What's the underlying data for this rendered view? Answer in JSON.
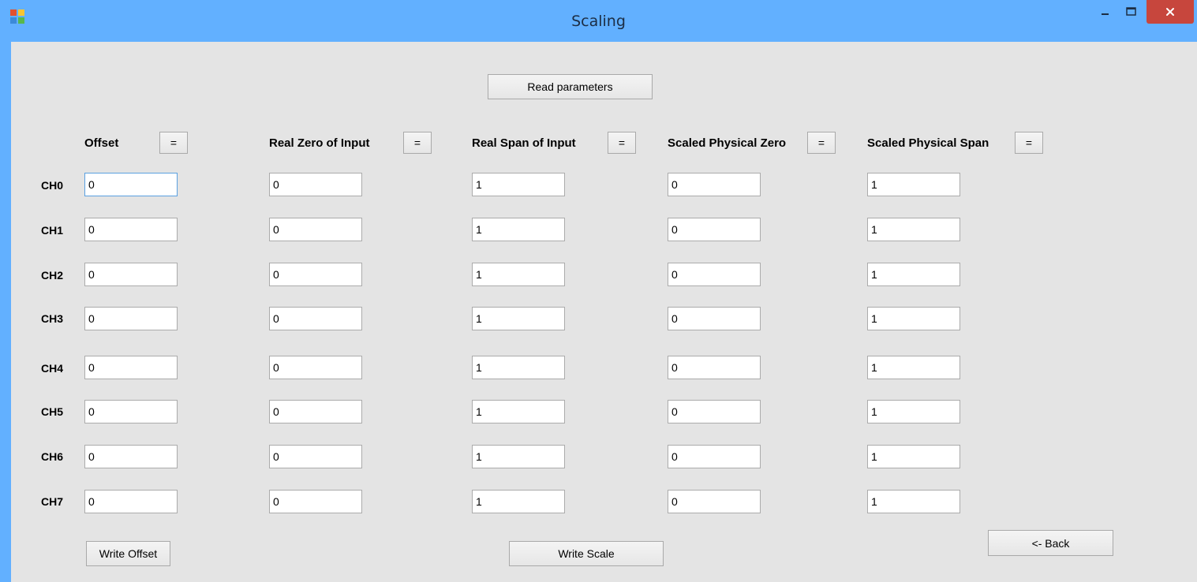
{
  "window": {
    "title": "Scaling",
    "minimize_glyph": "–",
    "maximize_glyph": "☐",
    "close_glyph": "✕"
  },
  "toolbar": {
    "read_parameters_label": "Read parameters",
    "write_offset_label": "Write Offset",
    "write_scale_label": "Write Scale",
    "back_label": "<- Back"
  },
  "columns": [
    {
      "key": "offset",
      "header": "Offset",
      "eq_label": "="
    },
    {
      "key": "real_zero",
      "header": "Real Zero of Input",
      "eq_label": "="
    },
    {
      "key": "real_span",
      "header": "Real Span of Input",
      "eq_label": "="
    },
    {
      "key": "scaled_zero",
      "header": "Scaled Physical Zero",
      "eq_label": "="
    },
    {
      "key": "scaled_span",
      "header": "Scaled Physical Span",
      "eq_label": "="
    }
  ],
  "rows": [
    {
      "label": "CH0",
      "values": [
        "0",
        "0",
        "1",
        "0",
        "1"
      ]
    },
    {
      "label": "CH1",
      "values": [
        "0",
        "0",
        "1",
        "0",
        "1"
      ]
    },
    {
      "label": "CH2",
      "values": [
        "0",
        "0",
        "1",
        "0",
        "1"
      ]
    },
    {
      "label": "CH3",
      "values": [
        "0",
        "0",
        "1",
        "0",
        "1"
      ]
    },
    {
      "label": "CH4",
      "values": [
        "0",
        "0",
        "1",
        "0",
        "1"
      ]
    },
    {
      "label": "CH5",
      "values": [
        "0",
        "0",
        "1",
        "0",
        "1"
      ]
    },
    {
      "label": "CH6",
      "values": [
        "0",
        "0",
        "1",
        "0",
        "1"
      ]
    },
    {
      "label": "CH7",
      "values": [
        "0",
        "0",
        "1",
        "0",
        "1"
      ]
    }
  ],
  "colors": {
    "titlebar": "#62b0ff",
    "client": "#e4e4e4",
    "close_button": "#c7463d"
  }
}
